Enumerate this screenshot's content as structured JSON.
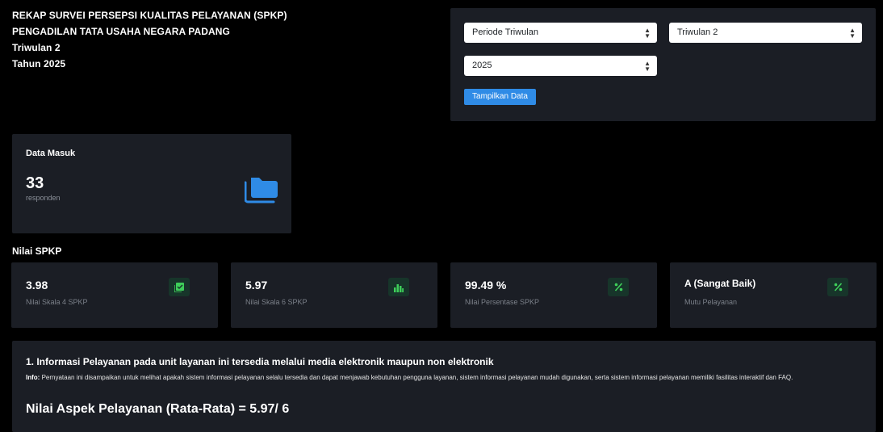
{
  "header": {
    "title_line1": "REKAP SURVEI PERSEPSI KUALITAS PELAYANAN (SPKP)",
    "title_line2": "PENGADILAN TATA USAHA NEGARA PADANG",
    "title_line3": "Triwulan 2",
    "title_line4": "Tahun 2025"
  },
  "filters": {
    "periode_value": "Periode Triwulan",
    "triwulan_value": "Triwulan 2",
    "tahun_value": "2025",
    "submit_label": "Tampilkan Data"
  },
  "data_masuk": {
    "label": "Data Masuk",
    "count": "33",
    "unit": "responden",
    "icon": "folder-icon"
  },
  "nilai_spkp": {
    "section_title": "Nilai SPKP",
    "cards": [
      {
        "value": "3.98",
        "caption": "Nilai Skala 4 SPKP",
        "icon": "check-square-icon"
      },
      {
        "value": "5.97",
        "caption": "Nilai Skala 6 SPKP",
        "icon": "bar-chart-icon"
      },
      {
        "value": "99.49 %",
        "caption": "Nilai Persentase SPKP",
        "icon": "percent-icon"
      },
      {
        "value": "A (Sangat Baik)",
        "caption": "Mutu Pelayanan",
        "icon": "percent-icon"
      }
    ]
  },
  "aspek": {
    "heading": "1. Informasi Pelayanan pada unit layanan ini tersedia melalui media elektronik maupun non elektronik",
    "info_label": "Info:",
    "info_text": "Pernyataan ini disampaikan untuk melihat apakah sistem informasi pelayanan selalu tersedia dan dapat menjawab kebutuhan pengguna layanan, sistem informasi pelayanan mudah digunakan, serta sistem informasi pelayanan memiliki fasilitas interaktif dan FAQ.",
    "nilai_label": "Nilai Aspek Pelayanan (Rata-Rata) = 5.97/ 6"
  },
  "colors": {
    "background": "#000000",
    "card": "#1b1e25",
    "accent_blue": "#2f8be6",
    "icon_green": "#3ecf5a",
    "icon_bg": "#17352a"
  }
}
